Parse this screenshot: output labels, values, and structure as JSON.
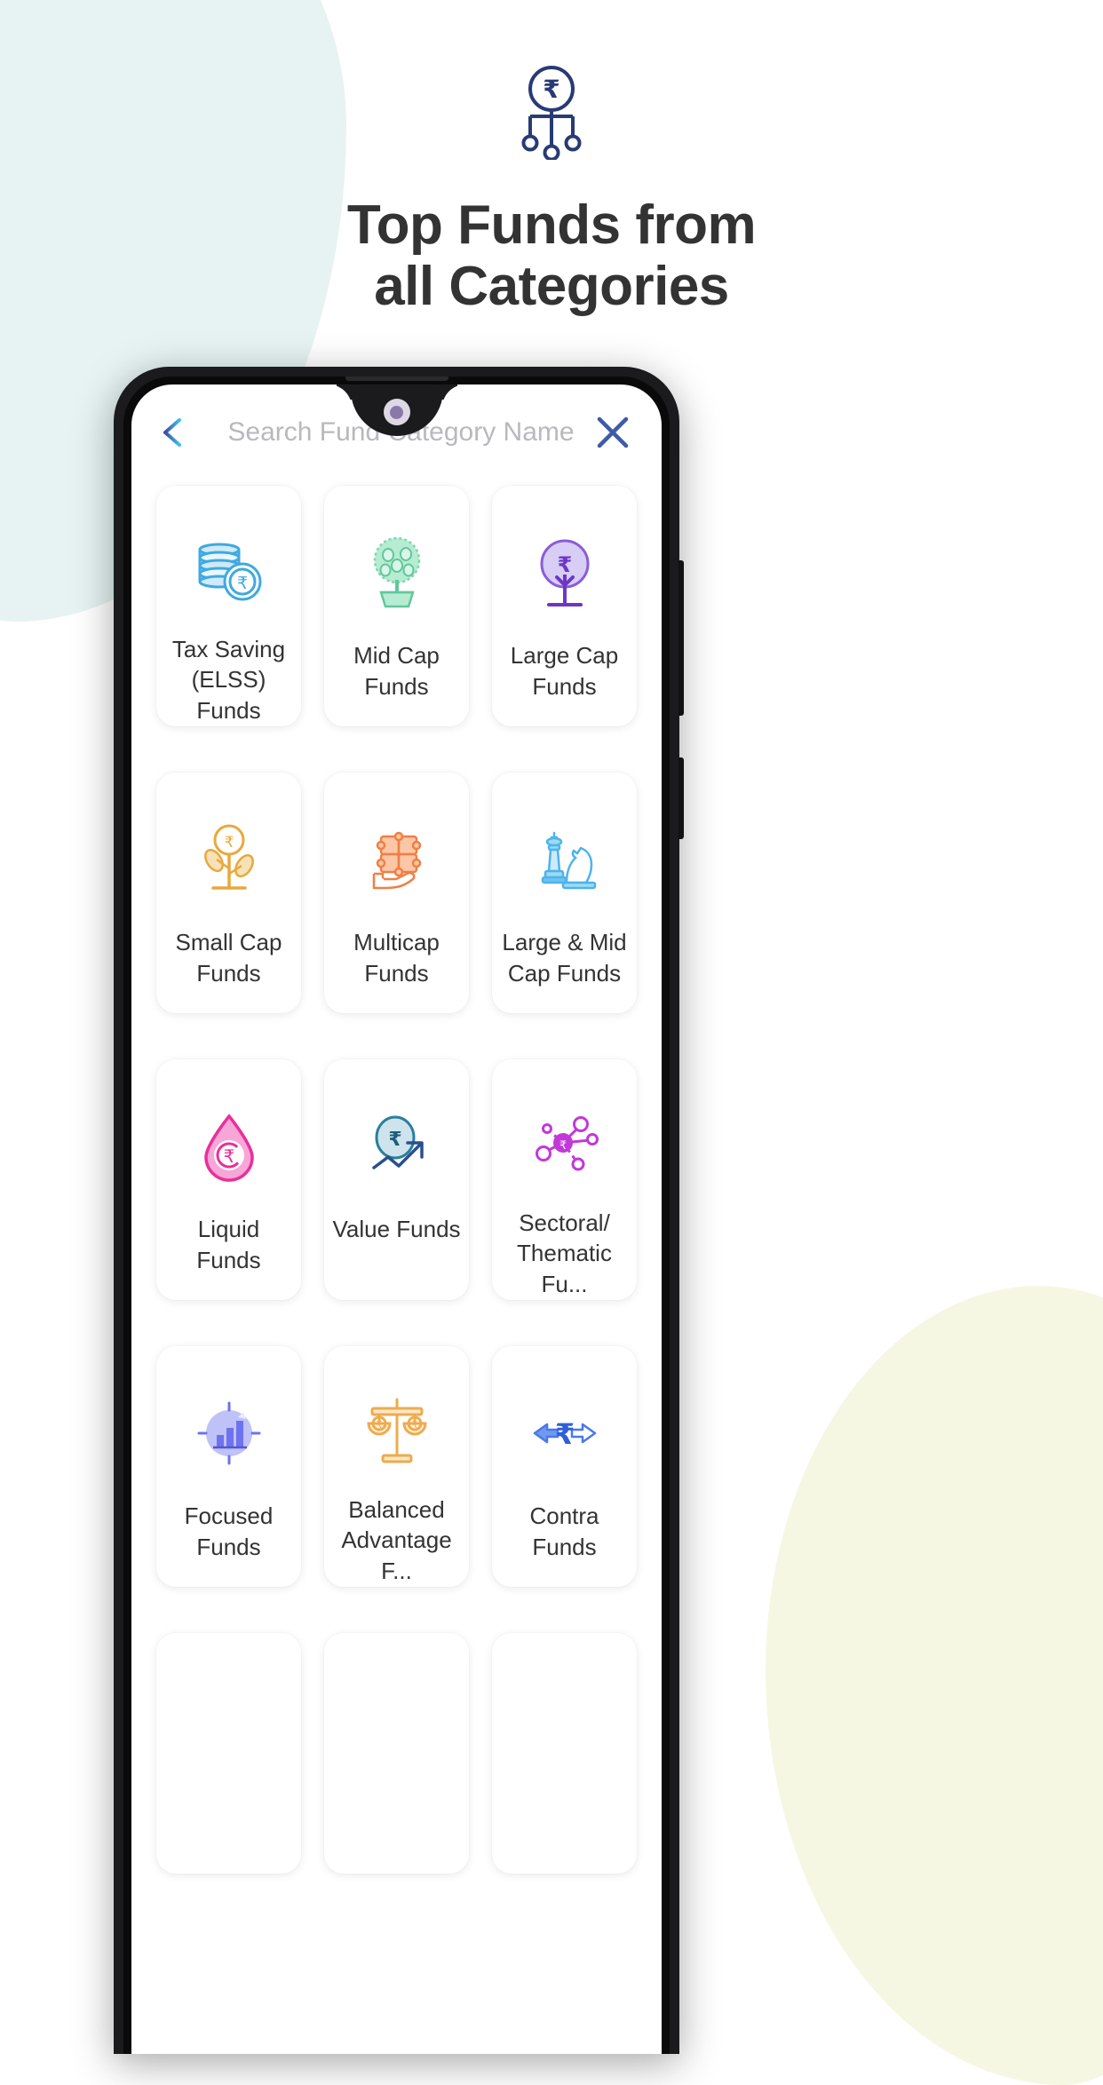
{
  "hero": {
    "logo_icon": "rupee-hierarchy-icon",
    "title_line1": "Top Funds from",
    "title_line2": "all Categories",
    "title_color": "#333333"
  },
  "colors": {
    "background": "#ffffff",
    "blob_mint": "#e6f3f2",
    "blob_cream": "#f6f7e3",
    "logo_navy": "#283b74",
    "phone_frame": "#1b1b1d",
    "placeholder_gray": "#b9b9bd",
    "label_gray": "#333333"
  },
  "app": {
    "search": {
      "back_icon": "back-arrow-icon",
      "placeholder": "Search Fund Category Name",
      "close_icon": "close-x-icon"
    },
    "cards": [
      {
        "label": "Tax Saving\n(ELSS) Funds",
        "icon": "coin-stack-icon",
        "color": "#3fa9e0"
      },
      {
        "label": "Mid Cap\nFunds",
        "icon": "money-tree-icon",
        "color": "#7fd6ae"
      },
      {
        "label": "Large Cap\nFunds",
        "icon": "rupee-tree-icon",
        "color": "#8b5cd6"
      },
      {
        "label": "Small Cap\nFunds",
        "icon": "sprout-rupee-icon",
        "color": "#e9a83c"
      },
      {
        "label": "Multicap\nFunds",
        "icon": "puzzle-hand-icon",
        "color": "#ef7f45"
      },
      {
        "label": "Large & Mid\nCap Funds",
        "icon": "chess-pieces-icon",
        "color": "#4eb3ea"
      },
      {
        "label": "Liquid Funds",
        "icon": "droplet-rupee-icon",
        "color": "#e8309a"
      },
      {
        "label": "Value Funds",
        "icon": "coin-growth-icon",
        "color": "#2a7f9e"
      },
      {
        "label": "Sectoral/\nThematic Fu...",
        "icon": "network-nodes-icon",
        "color": "#c238d8"
      },
      {
        "label": "Focused\nFunds",
        "icon": "target-chart-icon",
        "color": "#7b7df0"
      },
      {
        "label": "Balanced\nAdvantage F...",
        "icon": "balance-scale-icon",
        "color": "#eeab4e"
      },
      {
        "label": "Contra Funds",
        "icon": "contra-arrows-icon",
        "color": "#4a78e8"
      },
      {
        "label": "",
        "icon": "",
        "color": ""
      },
      {
        "label": "",
        "icon": "",
        "color": ""
      },
      {
        "label": "",
        "icon": "",
        "color": ""
      }
    ]
  }
}
